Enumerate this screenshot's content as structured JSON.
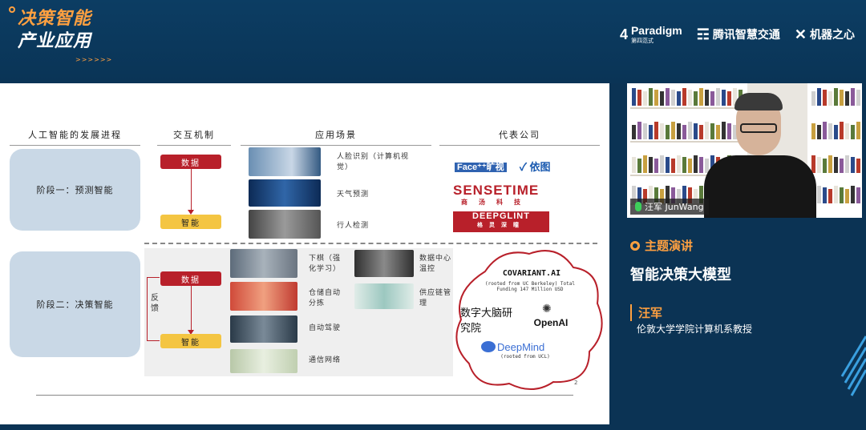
{
  "event": {
    "title_line1": "决策智能",
    "title_line2": "产业应用",
    "title_deco": ">>>>>>"
  },
  "sponsors": [
    {
      "name": "Paradigm",
      "sub": "第四范式"
    },
    {
      "name": "腾讯智慧交通"
    },
    {
      "name": "机器之心"
    }
  ],
  "slide": {
    "col_heads": [
      "人工智能的发展进程",
      "交互机制",
      "应用场景",
      "代表公司"
    ],
    "stage1": {
      "label": "阶段一：预测智能",
      "data_pill": "数据",
      "ai_pill": "智能",
      "scenes": [
        "人脸识别（计算机视觉）",
        "天气预测",
        "行人检测"
      ],
      "companies": [
        "Face⁺⁺旷视",
        "依图",
        "SENSETIME",
        "商汤科技",
        "DEEPGLINT",
        "格灵深瞳"
      ]
    },
    "stage2": {
      "label": "阶段二：决策智能",
      "data_pill": "数据",
      "ai_pill": "智能",
      "feedback": "反馈",
      "scenes_left": [
        "下棋（强化学习）",
        "仓储自动分拣",
        "自动驾驶",
        "通信网络"
      ],
      "scenes_right": [
        "数据中心温控",
        "供应链管理"
      ],
      "cloud": {
        "covariant": "COVARIANT.AI",
        "covariant_note": "(rooted from UC Berkeley) Total Funding 147 Million USD",
        "institute": "数字大脑研究院",
        "openai": "OpenAI",
        "deepmind": "DeepMind",
        "deepmind_note": "(rooted from UCL)"
      }
    },
    "page_number": "2"
  },
  "video": {
    "speaker_tag": "汪军 JunWang"
  },
  "info": {
    "section": "主题演讲",
    "talk_title": "智能决策大模型",
    "speaker_name": "汪军",
    "speaker_title": "伦敦大学学院计算机系教授"
  },
  "colors": {
    "brand_orange": "#ffa040",
    "background_navy": "#0b3354",
    "data_red": "#b8202a",
    "ai_yellow": "#f4c542"
  }
}
